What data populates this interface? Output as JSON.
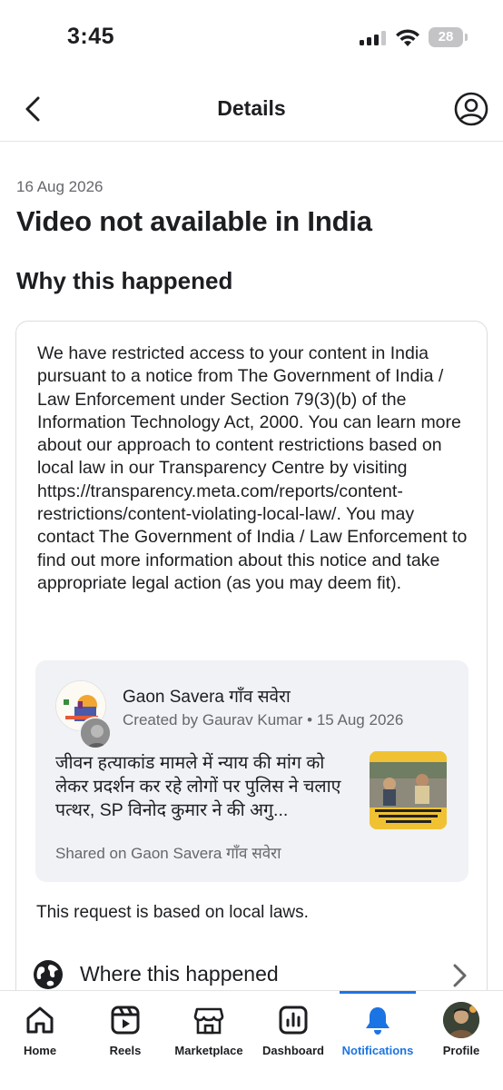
{
  "status_bar": {
    "time": "3:45",
    "battery": "28"
  },
  "header": {
    "title": "Details"
  },
  "date": "16 Aug 2026",
  "title": "Video not available in India",
  "section_title": "Why this happened",
  "notice": "We have restricted access to your content in India pursuant to a notice from The Government of India / Law Enforcement under Section 79(3)(b) of the Information Technology Act, 2000. You can learn more about our approach to content restrictions based on local law in our Transparency Centre by visiting https://transparency.meta.com/reports/content-restrictions/content-violating-local-law/. You may contact The Government of India / Law Enforcement to find out more information about this notice and take appropriate legal action (as you may deem fit).",
  "post": {
    "page_name": "Gaon Savera गाँव सवेरा",
    "meta": "Created by Gaurav Kumar • 15 Aug 2026",
    "text": "जीवन हत्याकांड मामले में न्याय की मांग को लेकर प्रदर्शन कर रहे लोगों पर पुलिस ने चलाए पत्थर, SP विनोद कुमार ने की अगु...",
    "shared": "Shared on Gaon Savera गाँव सवेरा"
  },
  "law_note": "This request is based on local laws.",
  "where_row": {
    "label": "Where this happened"
  },
  "tabs": [
    {
      "label": "Home",
      "icon": "home-icon"
    },
    {
      "label": "Reels",
      "icon": "reels-icon"
    },
    {
      "label": "Marketplace",
      "icon": "marketplace-icon"
    },
    {
      "label": "Dashboard",
      "icon": "dashboard-icon"
    },
    {
      "label": "Notifications",
      "icon": "bell-icon",
      "active": true
    },
    {
      "label": "Profile",
      "icon": "profile-avatar"
    }
  ],
  "colors": {
    "accent": "#1b74e4",
    "text": "#1c1e21",
    "secondary": "#65676b",
    "card_bg": "#f0f2f5"
  }
}
